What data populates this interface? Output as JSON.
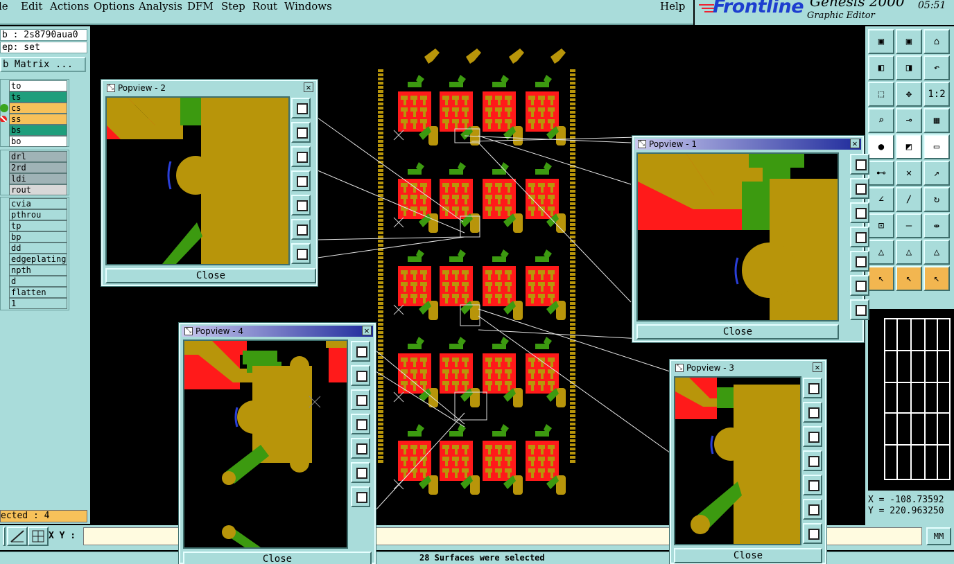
{
  "menu": {
    "items": [
      "le",
      "Edit",
      "Actions",
      "Options",
      "Analysis",
      "DFM",
      "Step",
      "Rout",
      "Windows"
    ],
    "help": "Help"
  },
  "brand": {
    "logo": "Frontline",
    "product": "Genesis 2000",
    "subtitle": "Graphic Editor",
    "time": "05:51"
  },
  "left": {
    "job": "b : 2s8790aua0",
    "step": "ep: set",
    "matrix_button": "b Matrix ...",
    "layers_board": [
      {
        "name": "to",
        "color": "#ffffff"
      },
      {
        "name": "ts",
        "color": "#1f9e7c"
      },
      {
        "name": "cs",
        "color": "#f7c15a"
      },
      {
        "name": "ss",
        "color": "#f7c15a"
      },
      {
        "name": "bs",
        "color": "#1f9e7c"
      },
      {
        "name": "bo",
        "color": "#ffffff"
      }
    ],
    "layers_drill": [
      {
        "name": "drl",
        "color": "#9fb3b6"
      },
      {
        "name": "2rd",
        "color": "#9fb3b6"
      },
      {
        "name": "ldi",
        "color": "#9fb3b6"
      },
      {
        "name": "rout",
        "color": "#d8d8d8"
      }
    ],
    "layers_misc": [
      {
        "name": "cvia",
        "color": "#a9dcda"
      },
      {
        "name": "pthrou",
        "color": "#a9dcda"
      },
      {
        "name": "tp",
        "color": "#a9dcda"
      },
      {
        "name": "bp",
        "color": "#a9dcda"
      },
      {
        "name": "dd",
        "color": "#a9dcda"
      },
      {
        "name": "edgeplating",
        "color": "#a9dcda"
      },
      {
        "name": "npth",
        "color": "#a9dcda"
      },
      {
        "name": "d",
        "color": "#a9dcda"
      },
      {
        "name": "flatten",
        "color": "#a9dcda"
      },
      {
        "name": "1",
        "color": "#a9dcda"
      }
    ],
    "selected": "ected : 4"
  },
  "bottom": {
    "xy_label": "X Y :",
    "xy_value": "",
    "units": "MM",
    "status": "28 Surfaces were selected"
  },
  "coords": {
    "x": "X = -108.73592",
    "y": "Y = 220.963250"
  },
  "popups": [
    {
      "title": "Popview - 2",
      "close": "Close"
    },
    {
      "title": "Popview - 1",
      "close": "Close"
    },
    {
      "title": "Popview - 4",
      "close": "Close"
    },
    {
      "title": "Popview - 3",
      "close": "Close"
    }
  ],
  "colors": {
    "panel": "#a9dcda",
    "copper": "#b8950a",
    "red": "#ff1a1a",
    "green": "#3c9a10",
    "canvas": "#000000"
  },
  "icons": [
    "home-icon",
    "undo-icon",
    "one-to-two-icon",
    "pointer-icon",
    "ruler-icon",
    "snap-icon"
  ]
}
